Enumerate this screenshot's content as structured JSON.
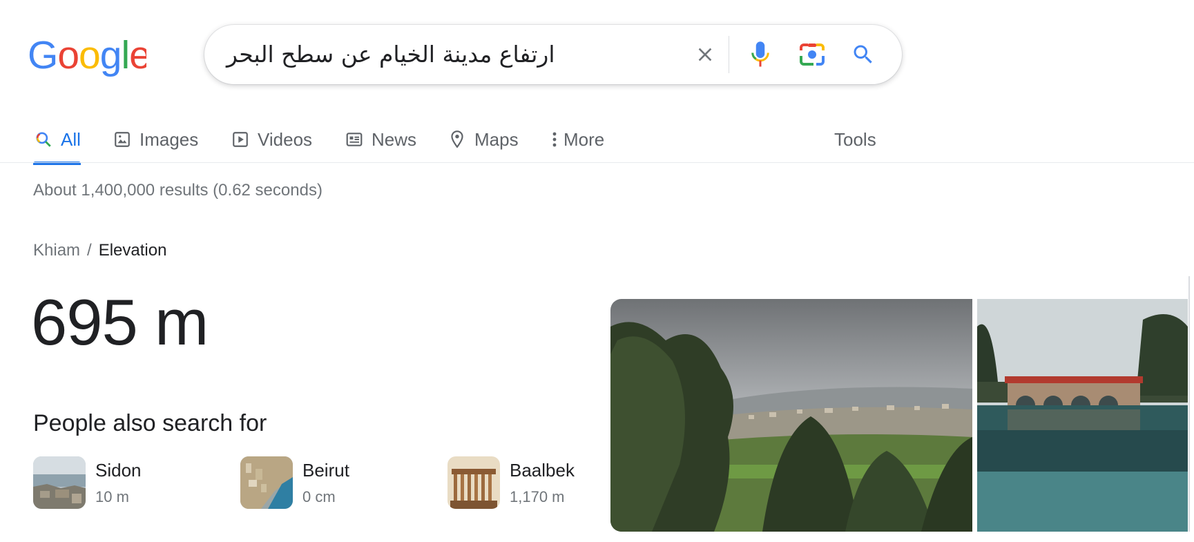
{
  "search": {
    "query": "ارتفاع مدينة الخيام عن سطح البحر",
    "icons": [
      "close-icon",
      "microphone-icon",
      "google-lens-icon",
      "search-icon"
    ]
  },
  "logo": {
    "letters": [
      "G",
      "o",
      "o",
      "g",
      "l",
      "e"
    ],
    "colors": [
      "#4285F4",
      "#EA4335",
      "#FBBC05",
      "#4285F4",
      "#34A853",
      "#EA4335"
    ]
  },
  "tabs": [
    {
      "label": "All",
      "icon": "search-icon",
      "active": true
    },
    {
      "label": "Images",
      "icon": "image-icon"
    },
    {
      "label": "Videos",
      "icon": "play-icon"
    },
    {
      "label": "News",
      "icon": "newspaper-icon"
    },
    {
      "label": "Maps",
      "icon": "map-pin-icon"
    },
    {
      "label": "More",
      "icon": "more-vert-icon"
    }
  ],
  "tools_label": "Tools",
  "result_stats": "About 1,400,000 results (0.62 seconds)",
  "breadcrumb": {
    "parent": "Khiam",
    "separator": "/",
    "current": "Elevation"
  },
  "answer": "695 m",
  "people_also_search": {
    "title": "People also search for",
    "items": [
      {
        "name": "Sidon",
        "value": "10 m"
      },
      {
        "name": "Beirut",
        "value": "0 cm"
      },
      {
        "name": "Baalbek",
        "value": "1,170 m"
      }
    ]
  },
  "colors": {
    "accent": "#1a73e8",
    "text": "#202124",
    "muted": "#70757a",
    "tab_text": "#5f6368"
  }
}
